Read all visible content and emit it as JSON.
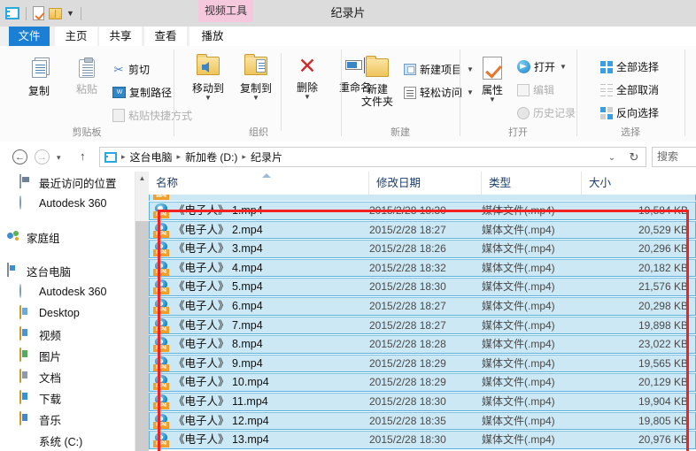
{
  "window": {
    "title": "纪录片",
    "contextual_tab_header": "视频工具"
  },
  "quick_access": {
    "items": [
      {
        "name": "video-library-icon",
        "label": "视频库"
      },
      {
        "name": "properties-icon",
        "label": "属性"
      },
      {
        "name": "new-folder-icon",
        "label": "新建文件夹"
      },
      {
        "name": "customize-chevron",
        "label": "▾"
      }
    ]
  },
  "ribbon": {
    "tabs": [
      {
        "label": "文件",
        "active": false,
        "accent": "#1b7fd4"
      },
      {
        "label": "主页",
        "active": true
      },
      {
        "label": "共享",
        "active": false
      },
      {
        "label": "查看",
        "active": false
      },
      {
        "label": "播放",
        "active": false
      }
    ],
    "groups": [
      {
        "label": "剪贴板",
        "big": [
          {
            "label": "复制",
            "icon": "copy-icon"
          },
          {
            "label": "粘贴",
            "icon": "paste-icon",
            "disabled": true
          }
        ],
        "small": [
          {
            "label": "剪切",
            "icon": "scissors-icon",
            "disabled": false
          },
          {
            "label": "复制路径",
            "icon": "copy-path-icon",
            "disabled": false
          },
          {
            "label": "粘贴快捷方式",
            "icon": "paste-shortcut-icon",
            "disabled": true
          }
        ]
      },
      {
        "label": "组织",
        "big": [
          {
            "label": "移动到",
            "icon": "move-to-icon",
            "dropdown": true
          },
          {
            "label": "复制到",
            "icon": "copy-to-icon",
            "dropdown": true
          },
          {
            "label": "删除",
            "icon": "delete-icon",
            "dropdown": true
          },
          {
            "label": "重命名",
            "icon": "rename-icon"
          }
        ]
      },
      {
        "label": "新建",
        "big": [
          {
            "label": "新建",
            "label2": "文件夹",
            "icon": "new-folder-icon"
          }
        ],
        "small": [
          {
            "label": "新建项目",
            "icon": "new-item-icon",
            "dropdown": true
          },
          {
            "label": "轻松访问",
            "icon": "easy-access-icon",
            "dropdown": true
          }
        ]
      },
      {
        "label": "打开",
        "big": [
          {
            "label": "属性",
            "icon": "properties-icon",
            "dropdown": true
          }
        ],
        "small": [
          {
            "label": "打开",
            "icon": "open-icon",
            "dropdown": true,
            "disabled": false
          },
          {
            "label": "编辑",
            "icon": "edit-icon",
            "disabled": true
          },
          {
            "label": "历史记录",
            "icon": "history-icon",
            "disabled": true
          }
        ]
      },
      {
        "label": "选择",
        "small": [
          {
            "label": "全部选择",
            "icon": "select-all-icon"
          },
          {
            "label": "全部取消",
            "icon": "select-none-icon"
          },
          {
            "label": "反向选择",
            "icon": "invert-selection-icon"
          }
        ]
      }
    ]
  },
  "address_bar": {
    "back": "←",
    "forward": "→",
    "recent_chevron": "▾",
    "up": "↑",
    "crumb_icon": "video-library-icon",
    "crumbs": [
      "这台电脑",
      "新加卷 (D:)",
      "纪录片"
    ],
    "separator": "▸",
    "dropdown": "⌄",
    "refresh": "↻",
    "search_placeholder": "搜索"
  },
  "sidebar": {
    "items": [
      {
        "label": "最近访问的位置",
        "icon": "recent-places-icon",
        "indent": 1,
        "group_start": false
      },
      {
        "label": "Autodesk 360",
        "icon": "autodesk-cloud-icon",
        "indent": 1,
        "group_start": false
      },
      {
        "label": "家庭组",
        "icon": "homegroup-icon",
        "indent": 0,
        "group_start": true
      },
      {
        "label": "这台电脑",
        "icon": "this-pc-icon",
        "indent": 0,
        "group_start": true
      },
      {
        "label": "Autodesk 360",
        "icon": "autodesk-cloud-icon",
        "indent": 1,
        "group_start": false
      },
      {
        "label": "Desktop",
        "icon": "desktop-folder-icon",
        "indent": 1,
        "group_start": false
      },
      {
        "label": "视频",
        "icon": "videos-folder-icon",
        "indent": 1,
        "group_start": false
      },
      {
        "label": "图片",
        "icon": "pictures-folder-icon",
        "indent": 1,
        "group_start": false
      },
      {
        "label": "文档",
        "icon": "documents-folder-icon",
        "indent": 1,
        "group_start": false
      },
      {
        "label": "下载",
        "icon": "downloads-folder-icon",
        "indent": 1,
        "group_start": false
      },
      {
        "label": "音乐",
        "icon": "music-folder-icon",
        "indent": 1,
        "group_start": false
      },
      {
        "label": "系统 (C:)",
        "icon": "drive-icon",
        "indent": 1,
        "group_start": false
      }
    ]
  },
  "file_list": {
    "columns": [
      {
        "label": "名称",
        "sorted": "asc"
      },
      {
        "label": "修改日期",
        "sorted": null
      },
      {
        "label": "类型",
        "sorted": null
      },
      {
        "label": "大小",
        "sorted": null
      }
    ],
    "selection_fill": "#cce8f4",
    "selection_border": "#5ab0dc",
    "rows": [
      {
        "name": "《电子人》 1.mp4",
        "date": "2015/2/28 18:30",
        "type": "媒体文件(.mp4)",
        "size": "19,584 KB",
        "selected": true
      },
      {
        "name": "《电子人》 2.mp4",
        "date": "2015/2/28 18:27",
        "type": "媒体文件(.mp4)",
        "size": "20,529 KB",
        "selected": true
      },
      {
        "name": "《电子人》 3.mp4",
        "date": "2015/2/28 18:26",
        "type": "媒体文件(.mp4)",
        "size": "20,296 KB",
        "selected": true
      },
      {
        "name": "《电子人》 4.mp4",
        "date": "2015/2/28 18:32",
        "type": "媒体文件(.mp4)",
        "size": "20,182 KB",
        "selected": true
      },
      {
        "name": "《电子人》 5.mp4",
        "date": "2015/2/28 18:30",
        "type": "媒体文件(.mp4)",
        "size": "21,576 KB",
        "selected": true
      },
      {
        "name": "《电子人》 6.mp4",
        "date": "2015/2/28 18:27",
        "type": "媒体文件(.mp4)",
        "size": "20,298 KB",
        "selected": true
      },
      {
        "name": "《电子人》 7.mp4",
        "date": "2015/2/28 18:27",
        "type": "媒体文件(.mp4)",
        "size": "19,898 KB",
        "selected": true
      },
      {
        "name": "《电子人》 8.mp4",
        "date": "2015/2/28 18:28",
        "type": "媒体文件(.mp4)",
        "size": "23,022 KB",
        "selected": true
      },
      {
        "name": "《电子人》 9.mp4",
        "date": "2015/2/28 18:29",
        "type": "媒体文件(.mp4)",
        "size": "19,565 KB",
        "selected": true
      },
      {
        "name": "《电子人》 10.mp4",
        "date": "2015/2/28 18:29",
        "type": "媒体文件(.mp4)",
        "size": "20,129 KB",
        "selected": true
      },
      {
        "name": "《电子人》 11.mp4",
        "date": "2015/2/28 18:30",
        "type": "媒体文件(.mp4)",
        "size": "19,904 KB",
        "selected": true
      },
      {
        "name": "《电子人》 12.mp4",
        "date": "2015/2/28 18:35",
        "type": "媒体文件(.mp4)",
        "size": "19,805 KB",
        "selected": true
      },
      {
        "name": "《电子人》 13.mp4",
        "date": "2015/2/28 18:30",
        "type": "媒体文件(.mp4)",
        "size": "20,976 KB",
        "selected": true
      }
    ],
    "file_icon": "mp4-media-icon",
    "file_icon_label": "MP4"
  },
  "annotation": {
    "type": "rectangle",
    "color": "#f52020"
  }
}
